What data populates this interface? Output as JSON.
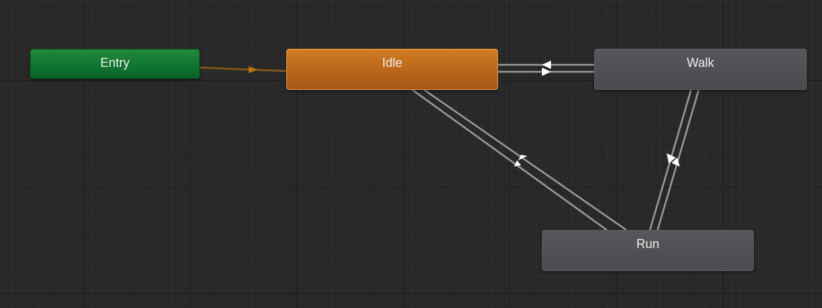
{
  "graph": {
    "states": {
      "entry": {
        "label": "Entry"
      },
      "idle": {
        "label": "Idle"
      },
      "walk": {
        "label": "Walk"
      },
      "run": {
        "label": "Run"
      }
    },
    "transitions": [
      {
        "from": "entry",
        "to": "idle"
      },
      {
        "from": "idle",
        "to": "walk"
      },
      {
        "from": "walk",
        "to": "idle"
      },
      {
        "from": "idle",
        "to": "run"
      },
      {
        "from": "run",
        "to": "idle"
      },
      {
        "from": "walk",
        "to": "run"
      },
      {
        "from": "run",
        "to": "walk"
      }
    ]
  },
  "colors": {
    "background": "#282828",
    "entry": "#117532",
    "default_state": "#b9661a",
    "state": "#4a4b4e",
    "transition": "#9a9a9a",
    "entry_transition": "#8a5a12",
    "arrow": "#ffffff"
  }
}
